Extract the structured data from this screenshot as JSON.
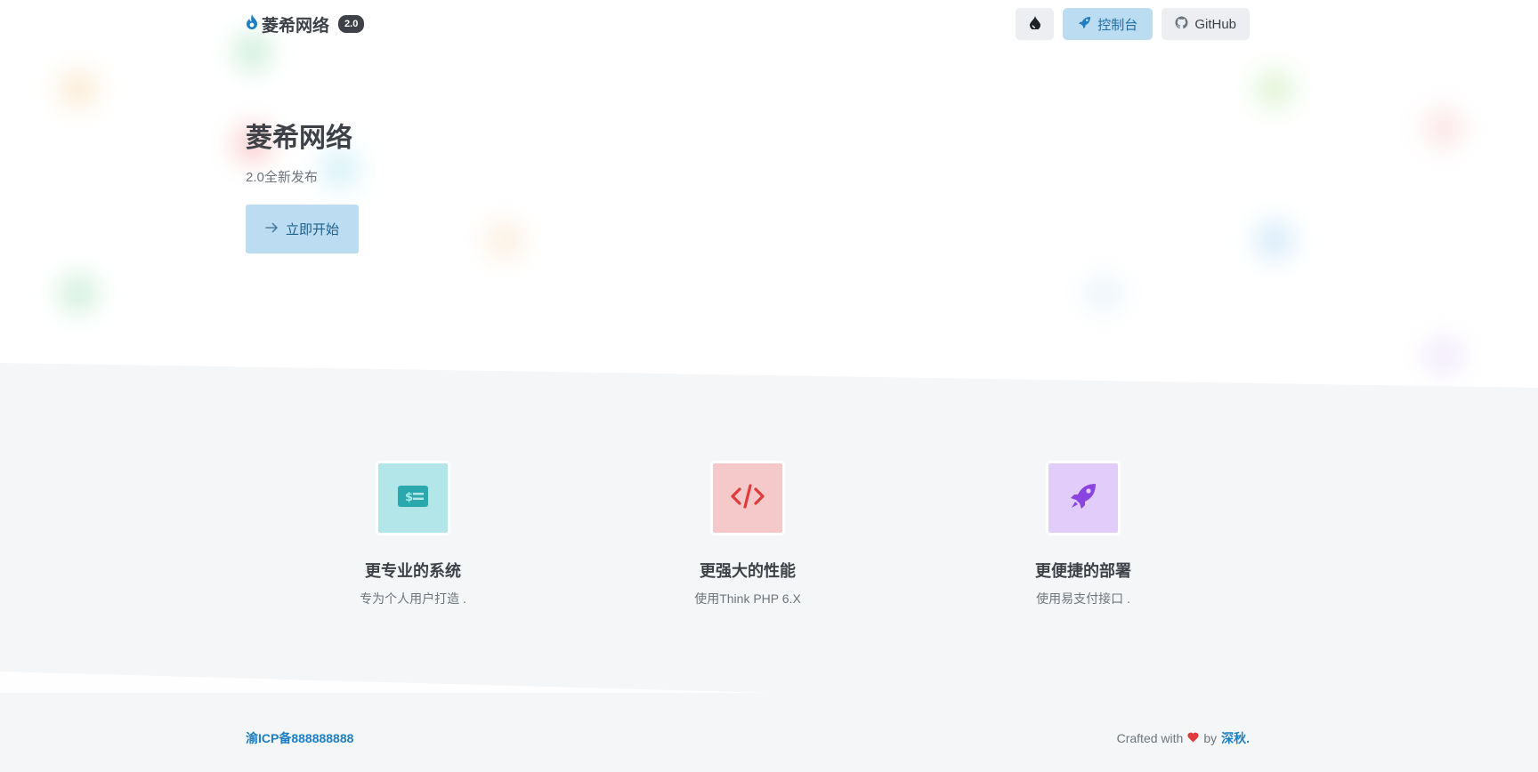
{
  "header": {
    "brand_name": "菱希网络",
    "version_badge": "2.0",
    "console_label": "控制台",
    "github_label": "GitHub"
  },
  "hero": {
    "title": "菱希网络",
    "subtitle": "2.0全新发布",
    "start_label": "立即开始"
  },
  "features": [
    {
      "title": "更专业的系统",
      "desc": "专为个人用户打造 .",
      "icon": "money-check-icon",
      "bg": "#b3e6e8",
      "fg": "#2aa8ad"
    },
    {
      "title": "更强大的性能",
      "desc": "使用Think PHP 6.X",
      "icon": "code-icon",
      "bg": "#f5c9c9",
      "fg": "#e03a3a"
    },
    {
      "title": "更便捷的部署",
      "desc": "使用易支付接口 .",
      "icon": "rocket-icon",
      "bg": "#e2cdfa",
      "fg": "#8a45e0"
    }
  ],
  "footer": {
    "icp": "渝ICP备888888888",
    "crafted_prefix": "Crafted with",
    "crafted_by": "by",
    "author": "深秋."
  },
  "colors": {
    "accent": "#1d7fc1",
    "heart": "#e03a3a"
  }
}
